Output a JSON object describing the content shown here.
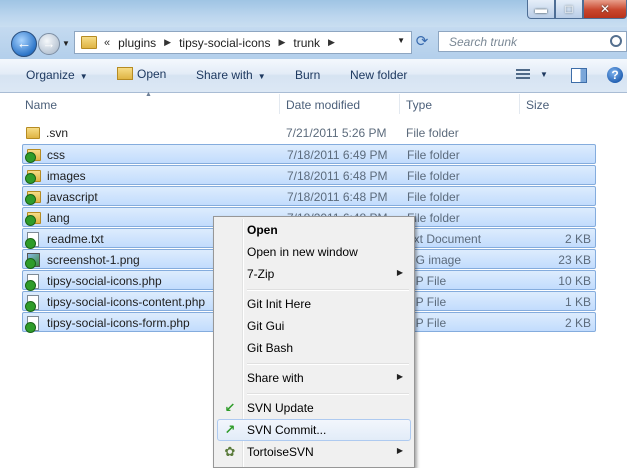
{
  "window": {
    "controls": [
      "minimize",
      "maximize",
      "close"
    ]
  },
  "address": {
    "overflow": "«",
    "crumbs": [
      "plugins",
      "tipsy-social-icons",
      "trunk"
    ],
    "search_placeholder": "Search trunk"
  },
  "toolbar": {
    "organize": "Organize",
    "open": "Open",
    "share_with": "Share with",
    "burn": "Burn",
    "new_folder": "New folder"
  },
  "columns": {
    "name": "Name",
    "date": "Date modified",
    "type": "Type",
    "size": "Size"
  },
  "files": [
    {
      "name": ".svn",
      "date": "7/21/2011 5:26 PM",
      "type": "File folder",
      "size": "",
      "icon": "folder-icon",
      "selected": false
    },
    {
      "name": "css",
      "date": "7/18/2011 6:49 PM",
      "type": "File folder",
      "size": "",
      "icon": "svn-folder-icon",
      "selected": true
    },
    {
      "name": "images",
      "date": "7/18/2011 6:48 PM",
      "type": "File folder",
      "size": "",
      "icon": "svn-folder-icon",
      "selected": true
    },
    {
      "name": "javascript",
      "date": "7/18/2011 6:48 PM",
      "type": "File folder",
      "size": "",
      "icon": "svn-folder-icon",
      "selected": true
    },
    {
      "name": "lang",
      "date": "7/18/2011 6:48 PM",
      "type": "File folder",
      "size": "",
      "icon": "svn-folder-icon",
      "selected": true
    },
    {
      "name": "readme.txt",
      "date": "",
      "type": "ext Document",
      "size": "2 KB",
      "icon": "svn-text-file-icon",
      "selected": true
    },
    {
      "name": "screenshot-1.png",
      "date": "",
      "type": "NG image",
      "size": "23 KB",
      "icon": "svn-image-file-icon",
      "selected": true
    },
    {
      "name": "tipsy-social-icons.php",
      "date": "",
      "type": "HP File",
      "size": "10 KB",
      "icon": "svn-php-file-icon",
      "selected": true
    },
    {
      "name": "tipsy-social-icons-content.php",
      "date": "",
      "type": "HP File",
      "size": "1 KB",
      "icon": "svn-php-file-icon",
      "selected": true
    },
    {
      "name": "tipsy-social-icons-form.php",
      "date": "",
      "type": "HP File",
      "size": "2 KB",
      "icon": "svn-php-file-icon",
      "selected": true
    }
  ],
  "context_menu": {
    "items": [
      {
        "label": "Open",
        "bold": true,
        "submenu": false,
        "icon": ""
      },
      {
        "label": "Open in new window",
        "bold": false,
        "submenu": false,
        "icon": ""
      },
      {
        "label": "7-Zip",
        "bold": false,
        "submenu": true,
        "icon": ""
      },
      {
        "label": "Git Init Here",
        "bold": false,
        "submenu": false,
        "icon": ""
      },
      {
        "label": "Git Gui",
        "bold": false,
        "submenu": false,
        "icon": ""
      },
      {
        "label": "Git Bash",
        "bold": false,
        "submenu": false,
        "icon": ""
      },
      {
        "label": "Share with",
        "bold": false,
        "submenu": true,
        "icon": ""
      },
      {
        "label": "SVN Update",
        "bold": false,
        "submenu": false,
        "icon": "svn-update-icon"
      },
      {
        "label": "SVN Commit...",
        "bold": false,
        "submenu": false,
        "icon": "svn-commit-icon",
        "highlighted": true
      },
      {
        "label": "TortoiseSVN",
        "bold": false,
        "submenu": true,
        "icon": "tortoisesvn-icon"
      }
    ]
  },
  "colors": {
    "selection_fill": "#c9e0fd",
    "selection_border": "#84acdd",
    "svn_ok_badge": "#2f9c2a",
    "menu_background": "#f0f0f0"
  }
}
